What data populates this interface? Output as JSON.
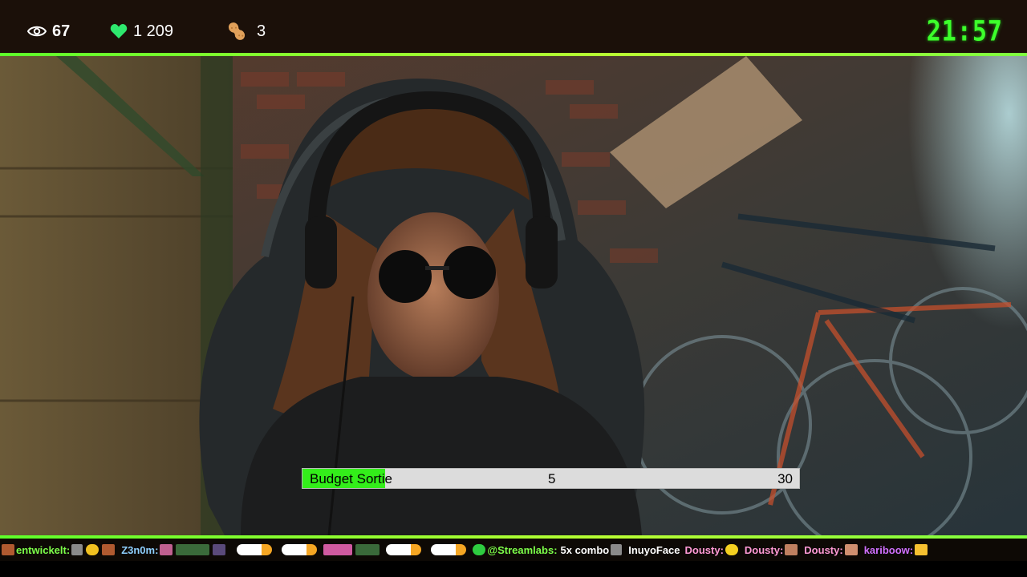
{
  "stats": {
    "viewers": "67",
    "likes": "1 209",
    "peanuts": "3"
  },
  "clock": "21:57",
  "goal": {
    "label": "Budget Sortie",
    "current": "5",
    "target": "30",
    "progress_fraction": 0.1667
  },
  "colors": {
    "accent": "#5dff2a",
    "clock": "#3dff2b",
    "heart": "#2ee86e",
    "goal_fill": "#33ee1a"
  },
  "icons": [
    "eye-icon",
    "heart-icon",
    "peanut-icon"
  ],
  "ticker": {
    "entries": [
      {
        "user": "entwickelt:",
        "style": "green"
      },
      {
        "user": "Z3n0m:",
        "style": "green"
      },
      {
        "user": "@Streamlabs:",
        "style": "green",
        "text": "5x combo"
      },
      {
        "user": "InuyoFace",
        "style": "green"
      },
      {
        "user": "Dousty:",
        "style": "pink"
      },
      {
        "user": "Dousty:",
        "style": "pink"
      },
      {
        "user": "Dousty:",
        "style": "pink"
      },
      {
        "user": "kariboow:",
        "style": "pink"
      }
    ]
  }
}
